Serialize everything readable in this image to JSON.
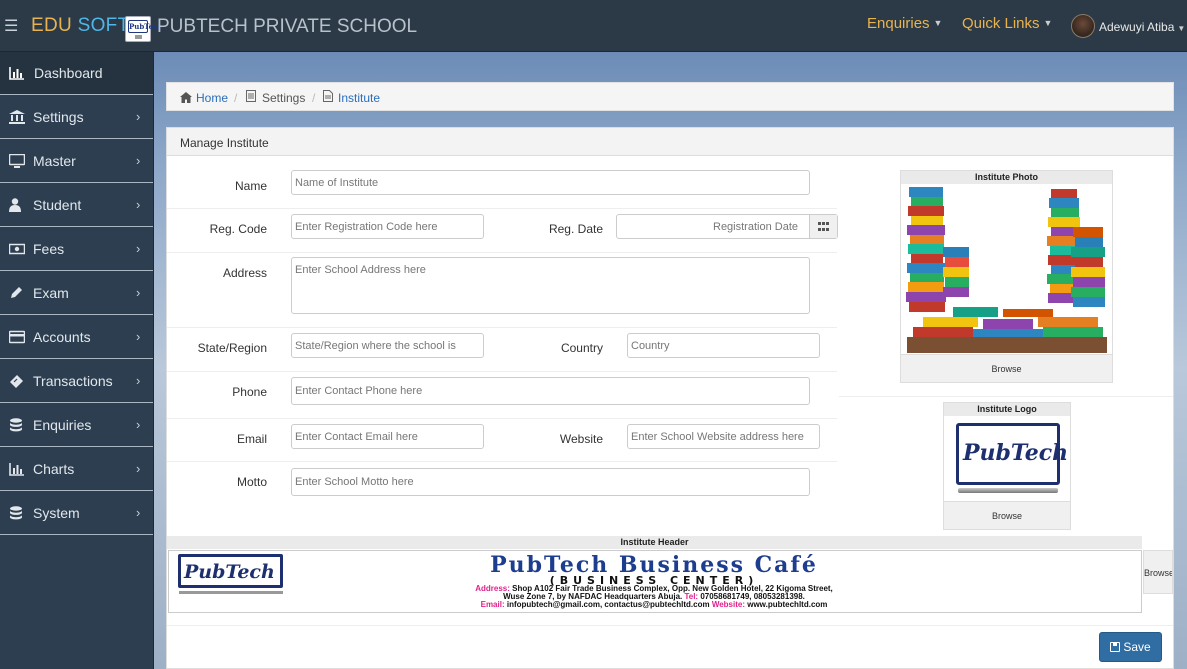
{
  "topbar": {
    "brand_edu": "EDU",
    "brand_soft": "SOFT",
    "logo_text": "PubTech",
    "school_name": "PUBTECH PRIVATE SCHOOL",
    "enquiries": "Enquiries",
    "quick_links": "Quick Links",
    "username": "Adewuyi Atiba"
  },
  "sidebar": {
    "items": [
      {
        "label": "Dashboard",
        "icon": "bar-chart-icon"
      },
      {
        "label": "Settings",
        "icon": "bank-icon"
      },
      {
        "label": "Master",
        "icon": "desktop-icon"
      },
      {
        "label": "Student",
        "icon": "user-icon"
      },
      {
        "label": "Fees",
        "icon": "money-icon"
      },
      {
        "label": "Exam",
        "icon": "pencil-icon"
      },
      {
        "label": "Accounts",
        "icon": "credit-card-icon"
      },
      {
        "label": "Transactions",
        "icon": "ticket-icon"
      },
      {
        "label": "Enquiries",
        "icon": "database-icon"
      },
      {
        "label": "Charts",
        "icon": "bar-chart-icon"
      },
      {
        "label": "System",
        "icon": "database-icon"
      }
    ]
  },
  "breadcrumb": {
    "home": "Home",
    "settings": "Settings",
    "institute": "Institute"
  },
  "panel": {
    "title": "Manage Institute"
  },
  "form": {
    "name_label": "Name",
    "name_placeholder": "Name of Institute",
    "regcode_label": "Reg. Code",
    "regcode_placeholder": "Enter Registration Code here",
    "regdate_label": "Reg. Date",
    "regdate_placeholder": "Registration Date",
    "address_label": "Address",
    "address_placeholder": "Enter School Address here",
    "state_label": "State/Region",
    "state_placeholder": "State/Region where the school is",
    "country_label": "Country",
    "country_placeholder": "Country",
    "phone_label": "Phone",
    "phone_placeholder": "Enter Contact Phone here",
    "email_label": "Email",
    "email_placeholder": "Enter Contact Email here",
    "website_label": "Website",
    "website_placeholder": "Enter School Website address here",
    "motto_label": "Motto",
    "motto_placeholder": "Enter School Motto here"
  },
  "images": {
    "photo_caption": "Institute Photo",
    "logo_caption": "Institute Logo",
    "header_caption": "Institute Header",
    "browse": "Browse",
    "logo_text": "PubTech"
  },
  "header_banner": {
    "logo_text": "PubTech",
    "title": "PubTech Business Café",
    "subtitle": "(BUSINESS CENTER)",
    "address_label": "Address:",
    "address_line1": " Shop A102 Fair Trade Business Complex, Opp. New Golden Hotel, 22 Kigoma Street,",
    "address_line2": "Wuse Zone 7, by NAFDAC Headquarters Abuja.",
    "tel_label": "Tel:",
    "tel": " 07058681749, 08053281398.",
    "email_label": "Email:",
    "email": " infopubtech@gmail.com, contactus@pubtechltd.com",
    "website_label": "Website:",
    "website": " www.pubtechltd.com"
  },
  "actions": {
    "save": "Save"
  },
  "colors": {
    "topbar": "#2b3a46",
    "sidebar": "#2c3e4f",
    "accent_orange": "#e8b34f",
    "link_blue": "#2a6ebb",
    "save_button": "#2f6da3"
  }
}
